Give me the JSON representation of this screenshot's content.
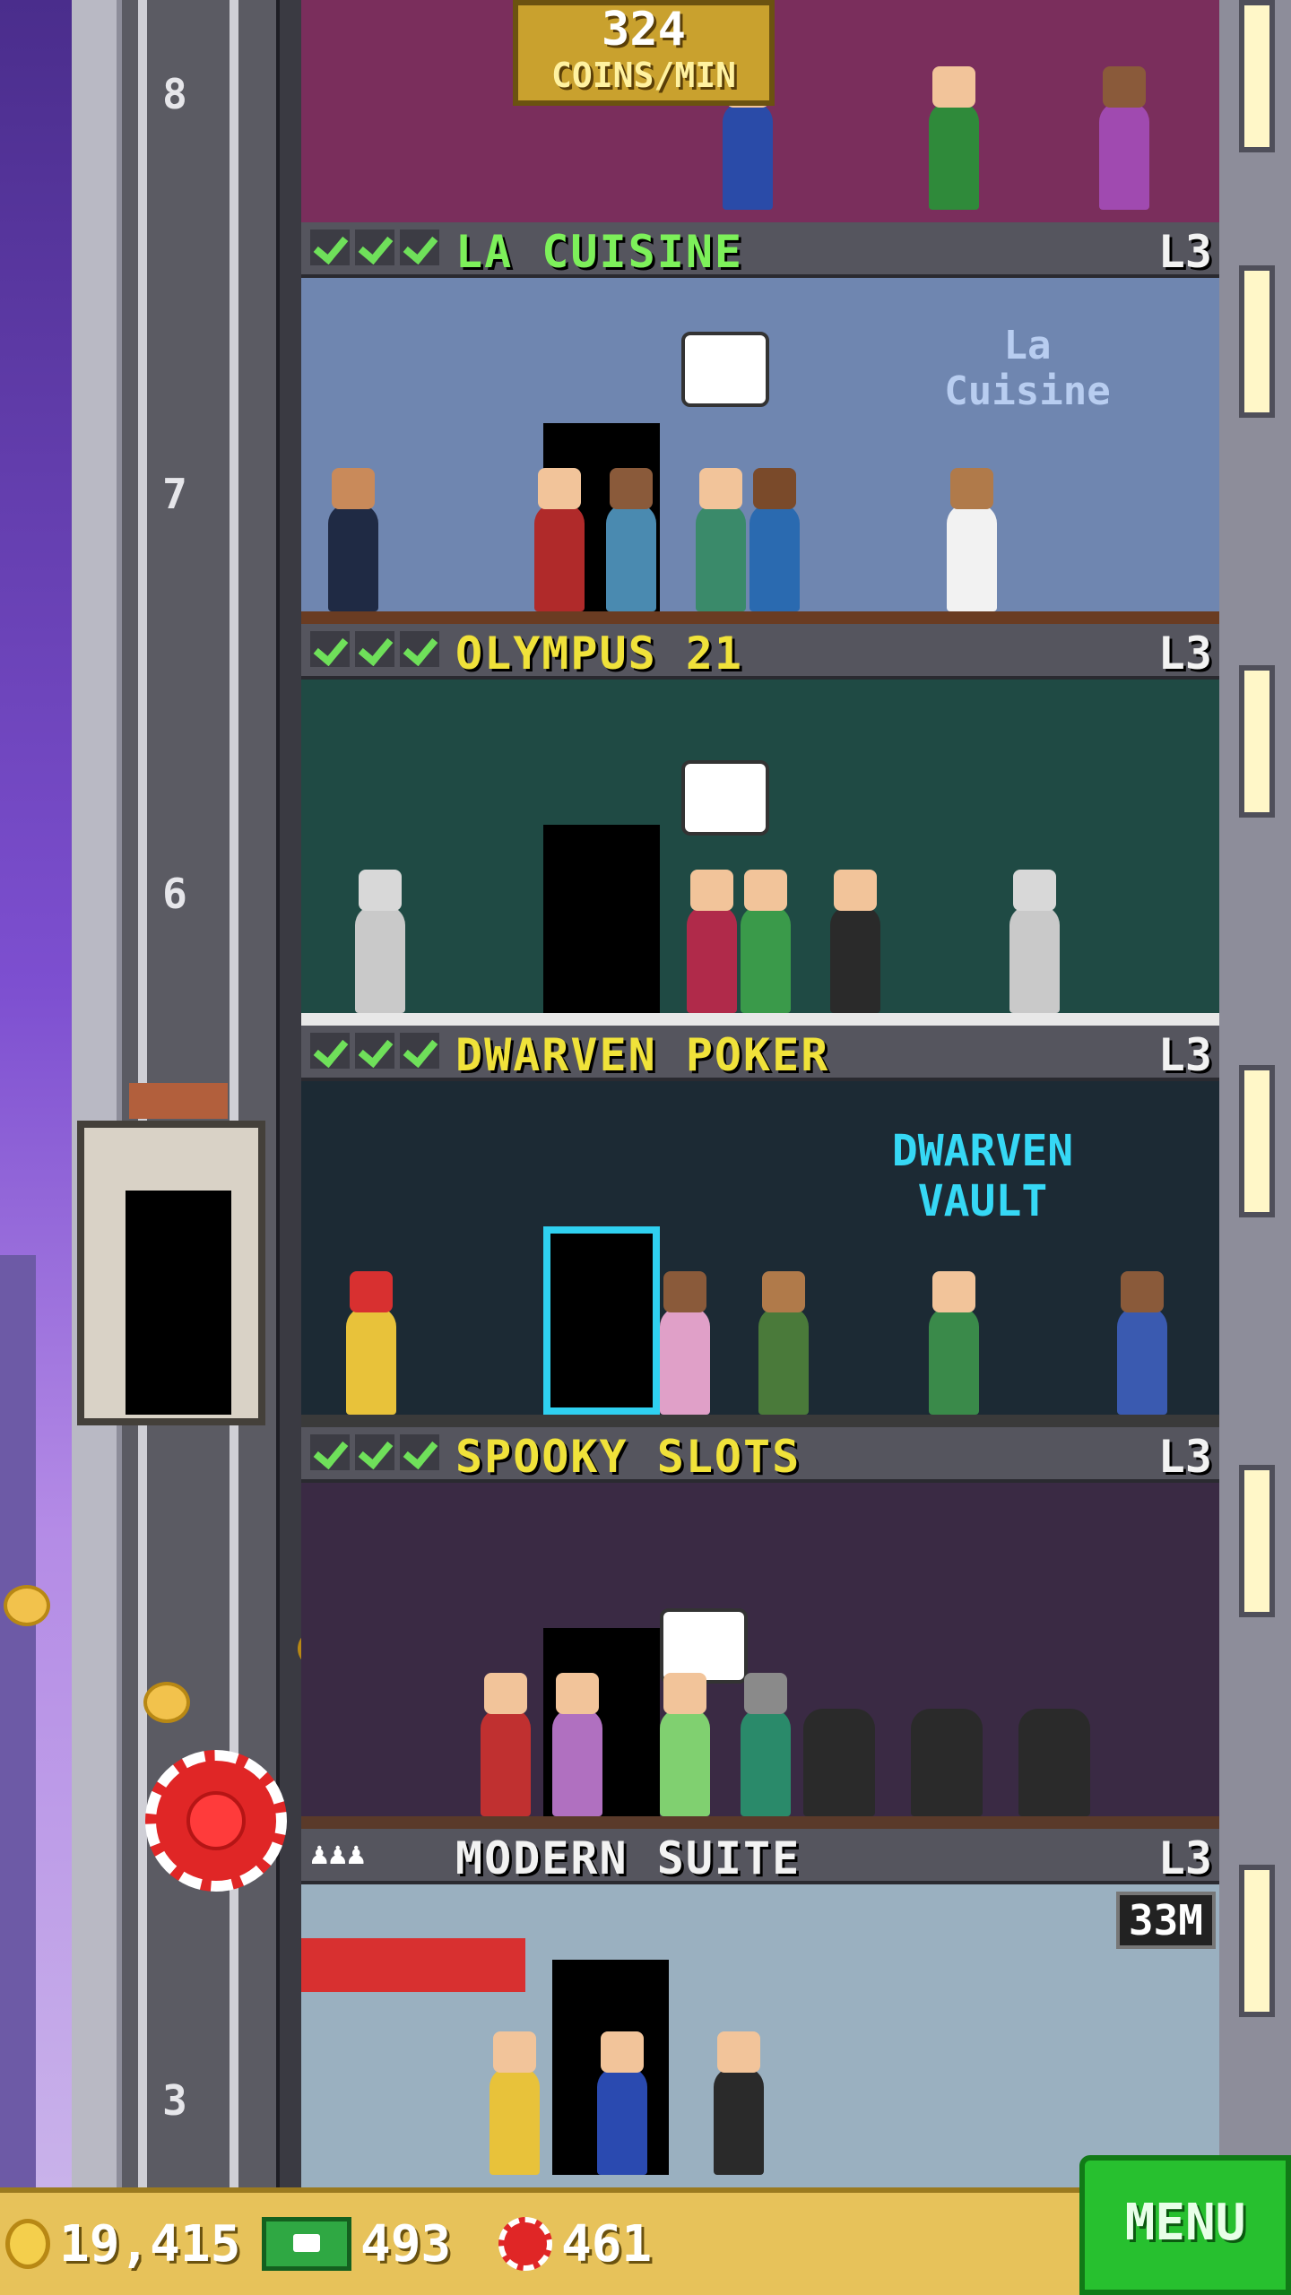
{
  "top_floor": {
    "rate_value": "324",
    "rate_unit": "COINS/MIN"
  },
  "shaft": {
    "floor_numbers": [
      "8",
      "7",
      "6",
      "3"
    ]
  },
  "floors": [
    {
      "name": "LA CUISINE",
      "level": "L3",
      "checks": 3,
      "name_color": "green",
      "sign": "La Cuisine"
    },
    {
      "name": "OLYMPUS 21",
      "level": "L3",
      "checks": 3,
      "name_color": "yellow"
    },
    {
      "name": "DWARVEN POKER",
      "level": "L3",
      "checks": 3,
      "name_color": "yellow",
      "sign": "DWARVEN VAULT"
    },
    {
      "name": "SPOOKY SLOTS",
      "level": "L3",
      "checks": 3,
      "name_color": "yellow"
    },
    {
      "name": "MODERN SUITE",
      "level": "L3",
      "checks": 0,
      "residents_icon": "people-icon",
      "name_color": "white",
      "price": "33M"
    }
  ],
  "bottom_bar": {
    "coins": "19,415",
    "bux": "493",
    "chips": "461",
    "menu_label": "MENU"
  },
  "colors": {
    "accent_green": "#27c02f",
    "bar_gold": "#e7c25a",
    "check_green": "#6fe05a"
  }
}
